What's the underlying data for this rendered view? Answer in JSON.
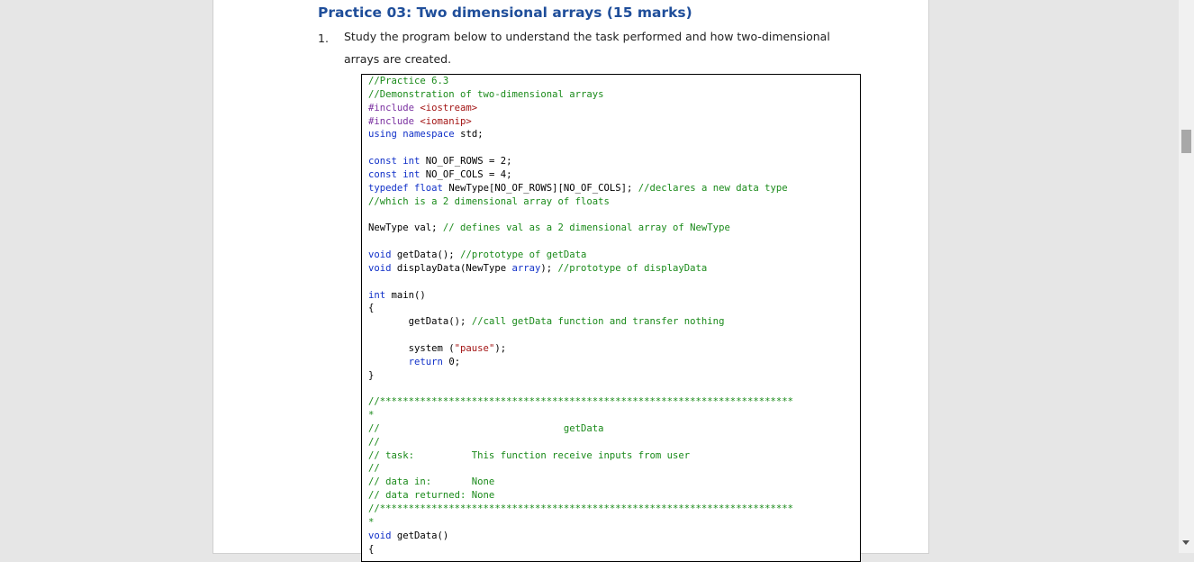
{
  "heading": "Practice 03: Two dimensional arrays (15 marks)",
  "item": {
    "number": "1.",
    "text": "Study the program below to understand the task performed and how two-dimensional arrays are created."
  },
  "code": [
    [
      [
        "cm",
        "//Practice 6.3"
      ]
    ],
    [
      [
        "cm",
        "//Demonstration of two-dimensional arrays"
      ]
    ],
    [
      [
        "pp",
        "#include "
      ],
      [
        "st",
        "<iostream>"
      ]
    ],
    [
      [
        "pp",
        "#include "
      ],
      [
        "st",
        "<iomanip>"
      ]
    ],
    [
      [
        "kw",
        "using"
      ],
      [
        "tx",
        " "
      ],
      [
        "kw",
        "namespace"
      ],
      [
        "tx",
        " std;"
      ]
    ],
    [
      [
        "tx",
        ""
      ]
    ],
    [
      [
        "kw",
        "const"
      ],
      [
        "tx",
        " "
      ],
      [
        "kw",
        "int"
      ],
      [
        "tx",
        " NO_OF_ROWS = 2;"
      ]
    ],
    [
      [
        "kw",
        "const"
      ],
      [
        "tx",
        " "
      ],
      [
        "kw",
        "int"
      ],
      [
        "tx",
        " NO_OF_COLS = 4;"
      ]
    ],
    [
      [
        "kw",
        "typedef"
      ],
      [
        "tx",
        " "
      ],
      [
        "kw",
        "float"
      ],
      [
        "tx",
        " NewType[NO_OF_ROWS][NO_OF_COLS]; "
      ],
      [
        "cm",
        "//declares a new data type"
      ]
    ],
    [
      [
        "cm",
        "//which is a 2 dimensional array of floats"
      ]
    ],
    [
      [
        "tx",
        ""
      ]
    ],
    [
      [
        "tx",
        "NewType val; "
      ],
      [
        "cm",
        "// defines val as a 2 dimensional array of NewType"
      ]
    ],
    [
      [
        "tx",
        ""
      ]
    ],
    [
      [
        "kw",
        "void"
      ],
      [
        "tx",
        " getData(); "
      ],
      [
        "cm",
        "//prototype of getData"
      ]
    ],
    [
      [
        "kw",
        "void"
      ],
      [
        "tx",
        " displayData(NewType "
      ],
      [
        "kw",
        "array"
      ],
      [
        "tx",
        "); "
      ],
      [
        "cm",
        "//prototype of displayData"
      ]
    ],
    [
      [
        "tx",
        ""
      ]
    ],
    [
      [
        "kw",
        "int"
      ],
      [
        "tx",
        " main()"
      ]
    ],
    [
      [
        "tx",
        "{"
      ]
    ],
    [
      [
        "tx",
        "       getData(); "
      ],
      [
        "cm",
        "//call getData function and transfer nothing"
      ]
    ],
    [
      [
        "tx",
        ""
      ]
    ],
    [
      [
        "tx",
        "       system ("
      ],
      [
        "st",
        "\"pause\""
      ],
      [
        "tx",
        ");"
      ]
    ],
    [
      [
        "tx",
        "       "
      ],
      [
        "kw",
        "return"
      ],
      [
        "tx",
        " 0;"
      ]
    ],
    [
      [
        "tx",
        "}"
      ]
    ],
    [
      [
        "tx",
        ""
      ]
    ],
    [
      [
        "cm",
        "//************************************************************************"
      ]
    ],
    [
      [
        "cm",
        "*"
      ]
    ],
    [
      [
        "cm",
        "//                                getData"
      ]
    ],
    [
      [
        "cm",
        "//"
      ]
    ],
    [
      [
        "cm",
        "// task:          This function receive inputs from user"
      ]
    ],
    [
      [
        "cm",
        "//"
      ]
    ],
    [
      [
        "cm",
        "// data in:       None"
      ]
    ],
    [
      [
        "cm",
        "// data returned: None"
      ]
    ],
    [
      [
        "cm",
        "//************************************************************************"
      ]
    ],
    [
      [
        "cm",
        "*"
      ]
    ],
    [
      [
        "kw",
        "void"
      ],
      [
        "tx",
        " getData()"
      ]
    ],
    [
      [
        "tx",
        "{"
      ]
    ]
  ]
}
